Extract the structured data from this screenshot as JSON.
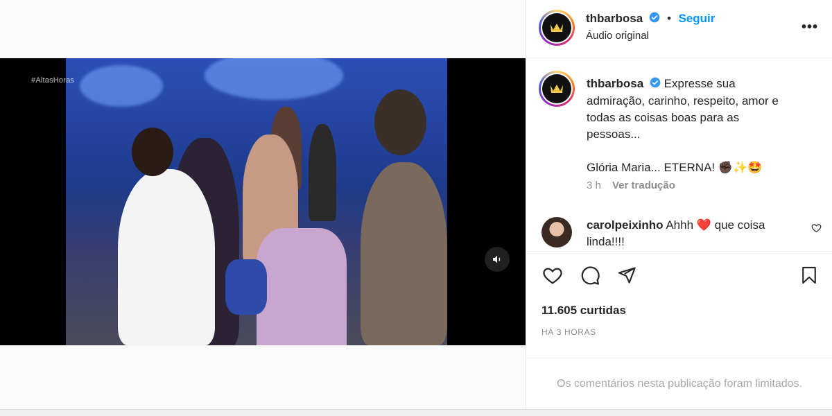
{
  "post": {
    "username": "thbarbosa",
    "follow_label": "Seguir",
    "separator": "•",
    "audio_label": "Áudio original",
    "more_label": "•••"
  },
  "video": {
    "watermark": "#AltasHoras"
  },
  "caption": {
    "username": "thbarbosa",
    "lines": [
      "Expresse sua",
      "admiração, carinho, respeito, amor e",
      "todas as coisas boas para as",
      "pessoas..."
    ],
    "second_line": "Glória Maria... ETERNA! ✊🏿✨🤩",
    "time_ago": "3 h",
    "translate_label": "Ver tradução"
  },
  "comment": {
    "username": "carolpeixinho",
    "text": "Ahhh ❤️ que coisa",
    "text_continued": "linda!!!!"
  },
  "stats": {
    "likes": "11.605 curtidas",
    "timestamp": "HÁ 3 HORAS"
  },
  "footer": {
    "limited_comments": "Os comentários nesta publicação foram limitados."
  },
  "icons": {
    "verified": "verified-badge-icon",
    "like": "heart-icon",
    "comment": "comment-icon",
    "share": "paper-plane-icon",
    "save": "bookmark-icon",
    "sound": "speaker-icon"
  },
  "colors": {
    "accent": "#0095f6",
    "muted": "#8e8e8e",
    "text": "#262626",
    "verified": "#3897f0"
  }
}
